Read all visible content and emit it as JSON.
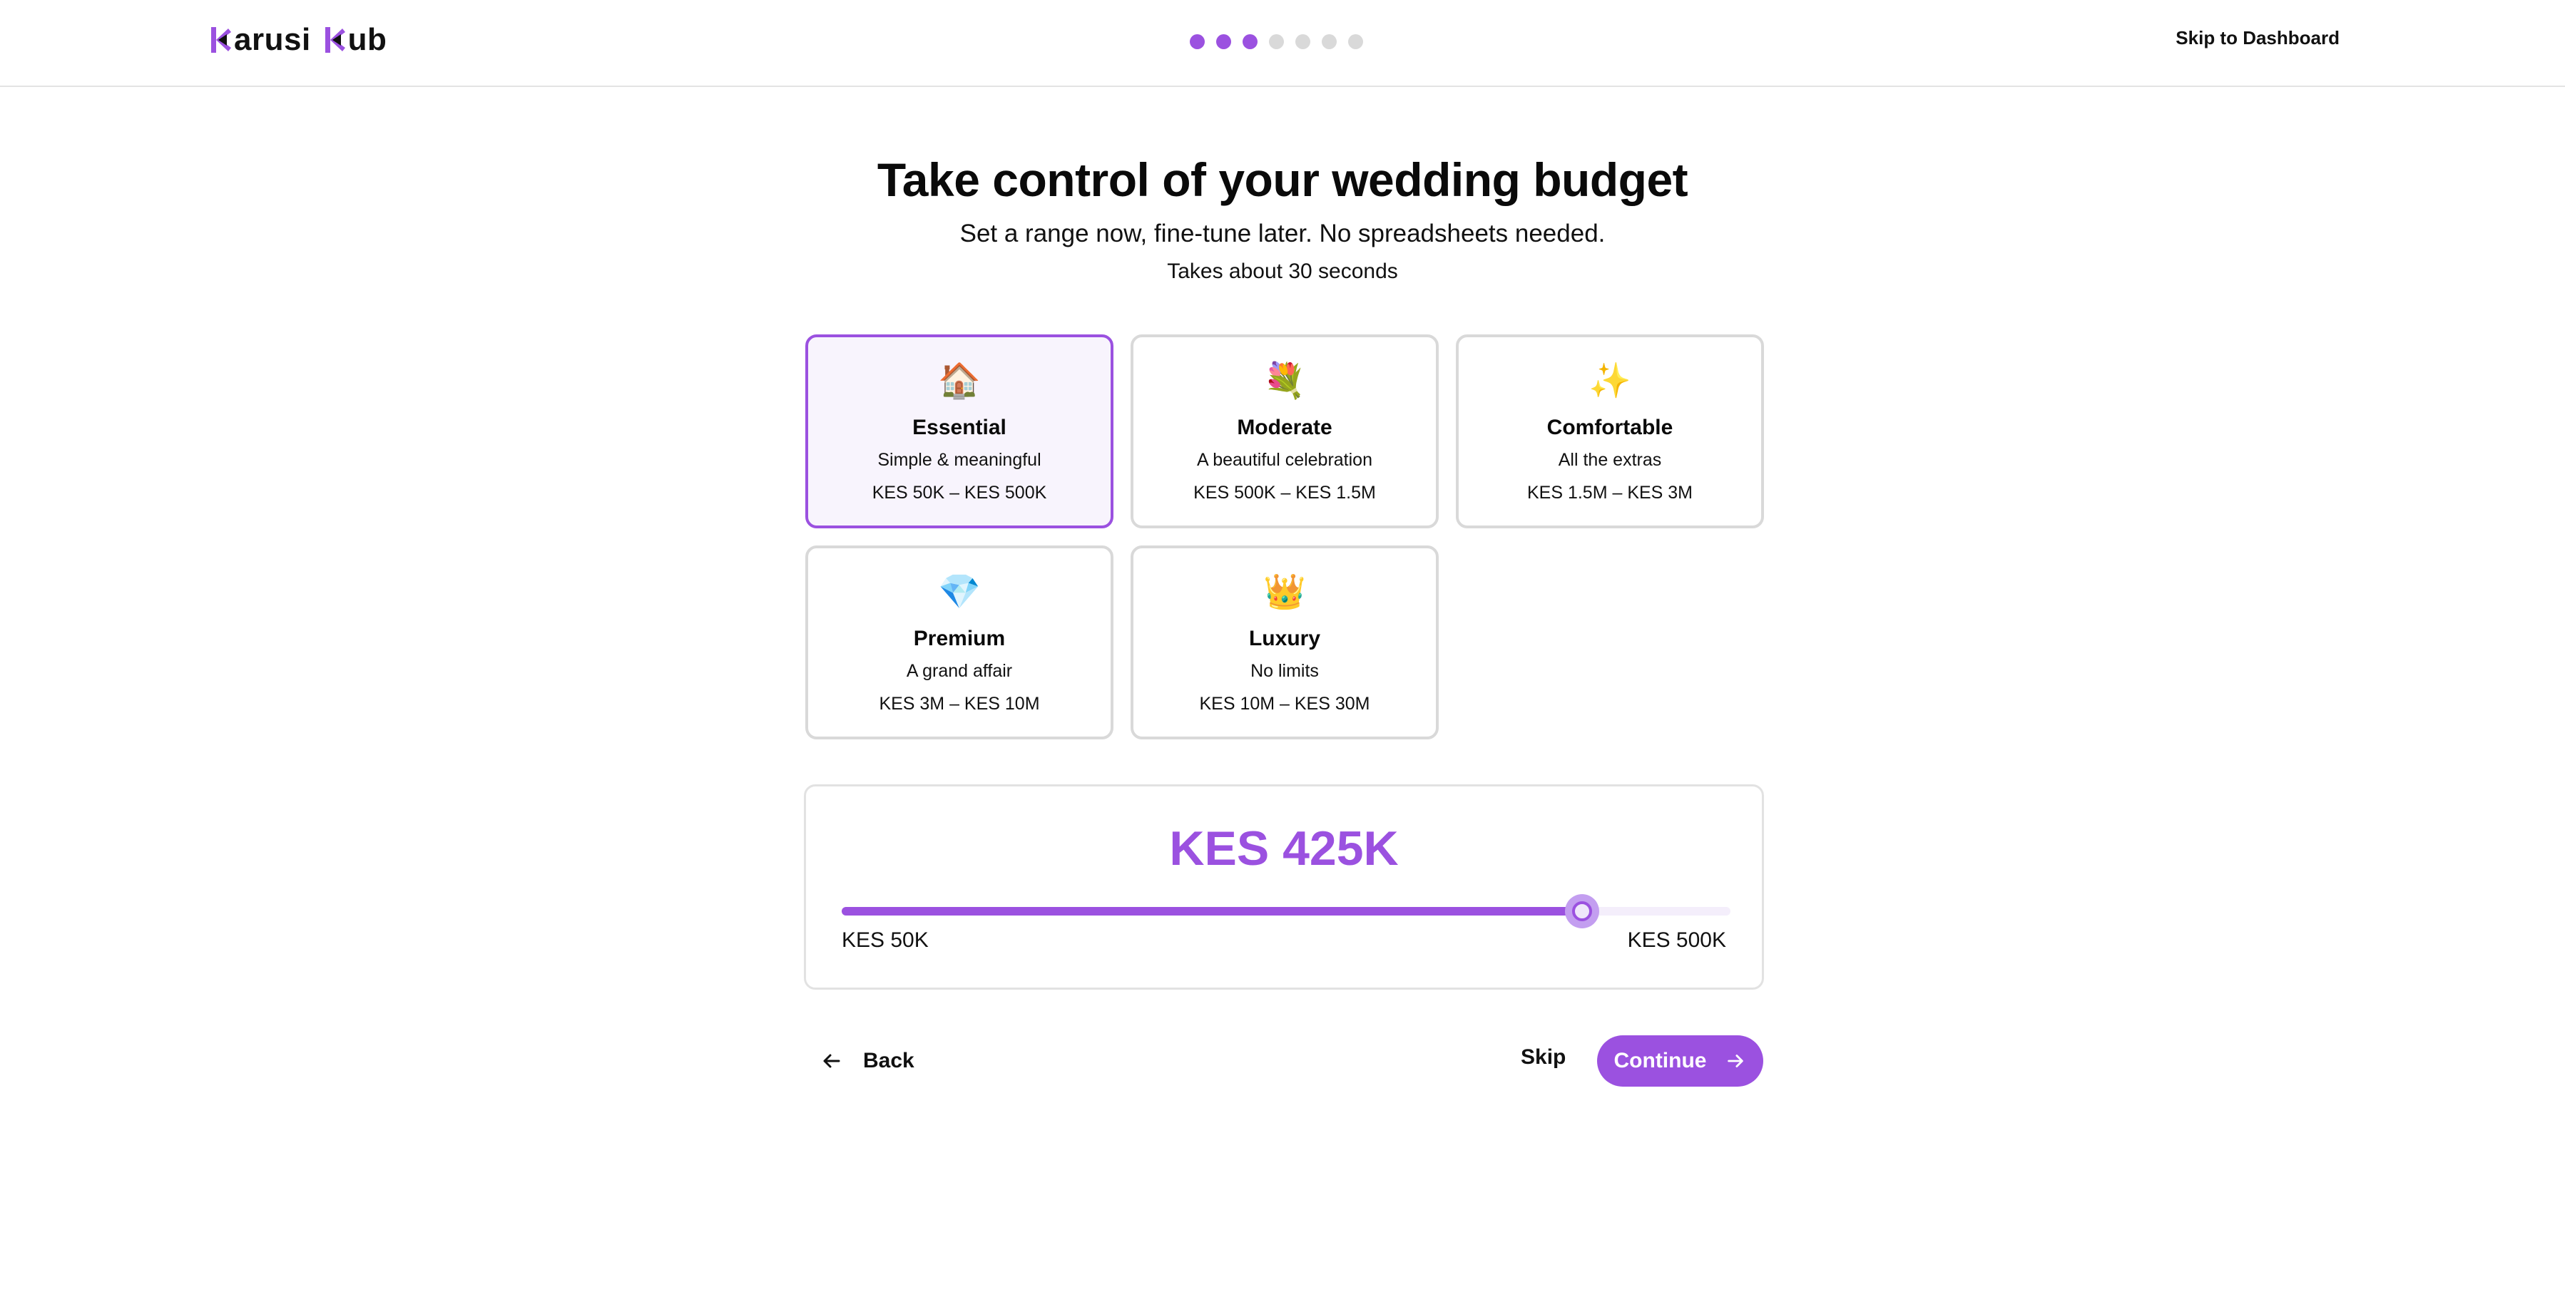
{
  "header": {
    "logo_part1": "arusi",
    "logo_part2": "ub",
    "steps_total": 7,
    "steps_completed": 3,
    "skip_dashboard_label": "Skip to Dashboard"
  },
  "hero": {
    "title": "Take control of your wedding budget",
    "subtitle": "Set a range now, fine-tune later. No spreadsheets needed.",
    "time_note": "Takes about 30 seconds"
  },
  "tiers": [
    {
      "icon": "🏠",
      "icon_name": "house-icon",
      "name": "Essential",
      "desc": "Simple & meaningful",
      "range": "KES 50K – KES 500K",
      "selected": true
    },
    {
      "icon": "💐",
      "icon_name": "bouquet-icon",
      "name": "Moderate",
      "desc": "A beautiful celebration",
      "range": "KES 500K – KES 1.5M",
      "selected": false
    },
    {
      "icon": "✨",
      "icon_name": "sparkles-icon",
      "name": "Comfortable",
      "desc": "All the extras",
      "range": "KES 1.5M – KES 3M",
      "selected": false
    },
    {
      "icon": "💎",
      "icon_name": "gem-icon",
      "name": "Premium",
      "desc": "A grand affair",
      "range": "KES 3M – KES 10M",
      "selected": false
    },
    {
      "icon": "👑",
      "icon_name": "crown-icon",
      "name": "Luxury",
      "desc": "No limits",
      "range": "KES 10M – KES 30M",
      "selected": false
    }
  ],
  "slider": {
    "value_label": "KES 425K",
    "min_label": "KES 50K",
    "max_label": "KES 500K",
    "min": 50000,
    "max": 500000,
    "value": 425000
  },
  "nav": {
    "back_label": "Back",
    "skip_label": "Skip",
    "continue_label": "Continue"
  },
  "colors": {
    "accent": "#9b51e0",
    "selected_bg": "#f8f4fd",
    "border": "#d9d9d9"
  }
}
